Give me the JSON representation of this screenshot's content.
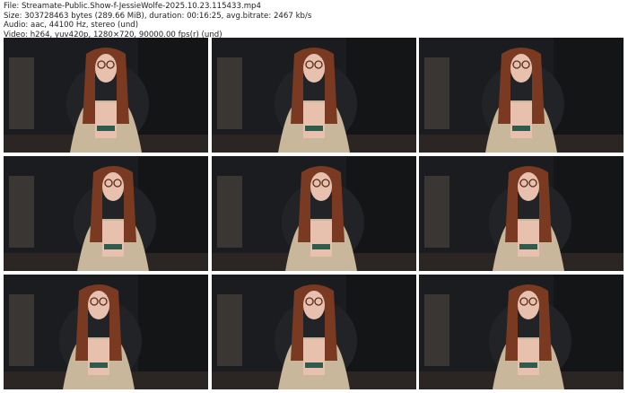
{
  "header": {
    "file_line": "File: Streamate-Public.Show-f-JessieWolfe-2025.10.23.115433.mp4",
    "size_line": "Size: 303728463 bytes (289.66 MiB), duration: 00:16:25, avg.bitrate: 2467 kb/s",
    "audio_line": "Audio: aac, 44100 Hz, stereo (und)",
    "video_line": "Video: h264, yuv420p, 1280×720, 90000.00 fps(r) (und)"
  },
  "thumbnails": [
    {
      "pose": "center"
    },
    {
      "pose": "center"
    },
    {
      "pose": "center"
    },
    {
      "pose": "right"
    },
    {
      "pose": "right"
    },
    {
      "pose": "right"
    },
    {
      "pose": "left"
    },
    {
      "pose": "center"
    },
    {
      "pose": "right"
    }
  ],
  "colors": {
    "background": "#ffffff",
    "room": "#1b1c1f",
    "hair": "#7a3a22",
    "skin": "#e7c1ad",
    "sweater": "#c9b79b"
  }
}
